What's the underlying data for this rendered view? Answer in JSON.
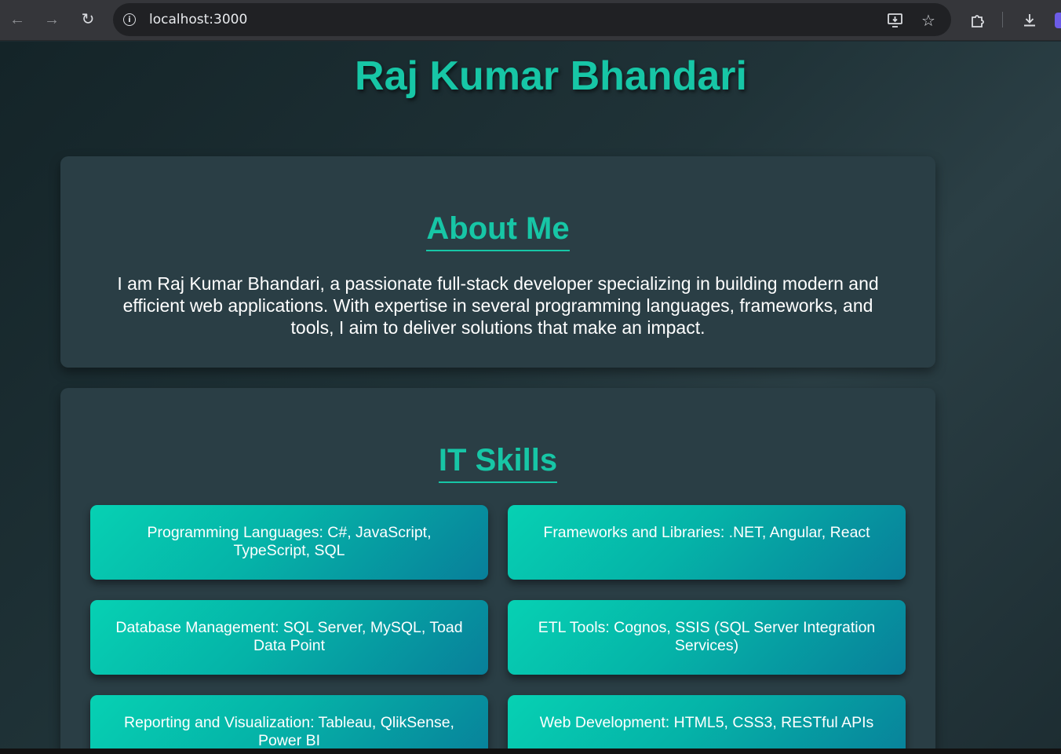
{
  "browser": {
    "url": "localhost:3000",
    "icons": {
      "back": "arrow-left-icon",
      "forward": "arrow-right-icon",
      "reload": "reload-icon",
      "site_info": "info-icon",
      "install": "install-app-icon",
      "bookmark": "star-icon",
      "extensions": "puzzle-icon",
      "downloads": "download-icon"
    }
  },
  "header": {
    "title": "Raj Kumar Bhandari"
  },
  "about": {
    "heading": "About Me",
    "text": "I am Raj Kumar Bhandari, a passionate full-stack developer specializing in building modern and efficient web applications. With expertise in several programming languages, frameworks, and tools, I aim to deliver solutions that make an impact."
  },
  "skills": {
    "heading": "IT Skills",
    "items": [
      "Programming Languages: C#, JavaScript, TypeScript, SQL",
      "Frameworks and Libraries: .NET, Angular, React",
      "Database Management: SQL Server, MySQL, Toad Data Point",
      "ETL Tools: Cognos, SSIS (SQL Server Integration Services)",
      "Reporting and Visualization: Tableau, QlikSense, Power BI",
      "Web Development: HTML5, CSS3, RESTful APIs"
    ]
  },
  "colors": {
    "accent": "#17c6a6",
    "card": "#2a3e45",
    "skill_start": "#06d1b3",
    "skill_end": "#087f9a"
  }
}
